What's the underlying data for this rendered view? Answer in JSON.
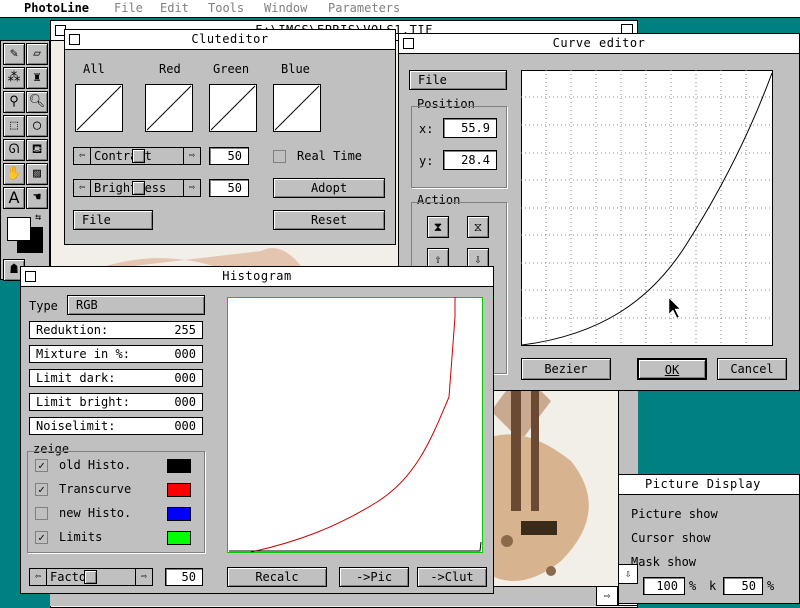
{
  "app": {
    "name": "PhotoLine",
    "menus": [
      "File",
      "Edit",
      "Tools",
      "Window",
      "Parameters"
    ]
  },
  "doc_window": {
    "title": "F:\\IMGS\\EPRIS\\VOLS1.TIF"
  },
  "cluteditor": {
    "title": "Cluteditor",
    "channels": [
      "All",
      "Red",
      "Green",
      "Blue"
    ],
    "contrast_label": "Contrast",
    "contrast_value": "50",
    "brightness_label": "Brightness",
    "brightness_value": "50",
    "realtime_label": "Real Time",
    "file_btn": "File",
    "adopt_btn": "Adopt",
    "reset_btn": "Reset"
  },
  "curve_editor": {
    "title": "Curve editor",
    "file_btn": "File",
    "position_label": "Position",
    "x_label": "x:",
    "x_value": "55.9",
    "y_label": "y:",
    "y_value": "28.4",
    "action_label": "Action",
    "action_field": "__",
    "bezier_btn": "Bezier",
    "ok_btn": "OK",
    "cancel_btn": "Cancel"
  },
  "histogram": {
    "title": "Histogram",
    "type_label": "Type",
    "type_value": "RGB",
    "rows": [
      {
        "label": "Reduktion:",
        "value": "255"
      },
      {
        "label": "Mixture in %:",
        "value": "000"
      },
      {
        "label": "Limit dark:",
        "value": "000"
      },
      {
        "label": "Limit bright:",
        "value": "000"
      },
      {
        "label": "Noiselimit:",
        "value": "000"
      }
    ],
    "zeige_label": "zeige",
    "zeige": [
      {
        "label": "old Histo.",
        "checked": "✓",
        "color": "#000000"
      },
      {
        "label": "Transcurve",
        "checked": "✓",
        "color": "#ff0000"
      },
      {
        "label": "new Histo.",
        "checked": "",
        "color": "#0000ff"
      },
      {
        "label": "Limits",
        "checked": "✓",
        "color": "#00ff00"
      }
    ],
    "factor_label": "Factor",
    "factor_value": "50",
    "recalc_btn": "Recalc",
    "topic_btn": "->Pic",
    "toclut_btn": "->Clut"
  },
  "picture_display": {
    "title": "Picture Display",
    "lines": [
      "Picture show",
      "Cursor show",
      "Mask show"
    ],
    "field1": "100",
    "unit1": "%",
    "k_label": "k",
    "field2": "50",
    "unit2": "%"
  },
  "colors": {
    "desktop": "#008080",
    "window_face": "#c0c0c0",
    "transcurve": "#cc0000",
    "limits": "#00cc00"
  }
}
